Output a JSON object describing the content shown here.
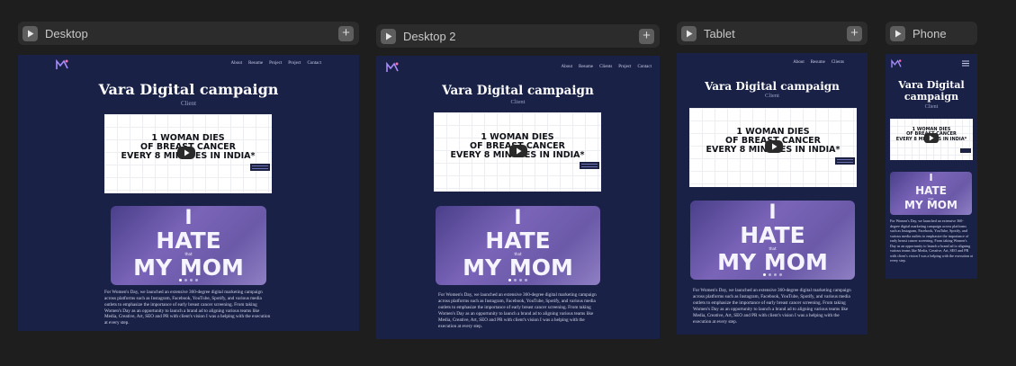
{
  "frames": [
    {
      "id": "desktop",
      "label": "Desktop",
      "has_plus": true,
      "has_hamburger": false,
      "nav": [
        "About",
        "Resume",
        "Project",
        "Project",
        "Contact"
      ]
    },
    {
      "id": "desktop2",
      "label": "Desktop 2",
      "has_plus": true,
      "has_hamburger": false,
      "nav": [
        "About",
        "Resume",
        "Clients",
        "Project",
        "Contact"
      ]
    },
    {
      "id": "tablet",
      "label": "Tablet",
      "has_plus": true,
      "has_hamburger": false,
      "nav": [
        "About",
        "Resume",
        "Clients"
      ]
    },
    {
      "id": "phone",
      "label": "Phone",
      "has_plus": false,
      "has_hamburger": true,
      "nav": []
    }
  ],
  "page": {
    "title": "Vara Digital campaign",
    "subtitle": "Client",
    "video_text": [
      "1 WOMAN DIES",
      "OF BREAST CANCER",
      "EVERY 8 MINUTES IN INDIA*"
    ],
    "hate_top": "I",
    "hate_mid": "HATE",
    "hate_that": "that",
    "hate_bottom": "MY MOM",
    "paragraph": "For Women's Day, we launched an extensive 360-degree digital marketing campaign across platforms such as Instagram, Facebook, YouTube, Spotify, and various media outlets to emphasize the importance of early breast cancer screening. From taking Women's Day as an opportunity to launch a brand ad to aligning various teams like Media, Creative, Art, SEO and PR with client's vision I was a helping with the execution at every step."
  },
  "colors": {
    "canvas_bg": "#1e1e1e",
    "site_bg": "#192147",
    "header_bg": "#2c2c2c",
    "accent": "#7a64b8"
  }
}
